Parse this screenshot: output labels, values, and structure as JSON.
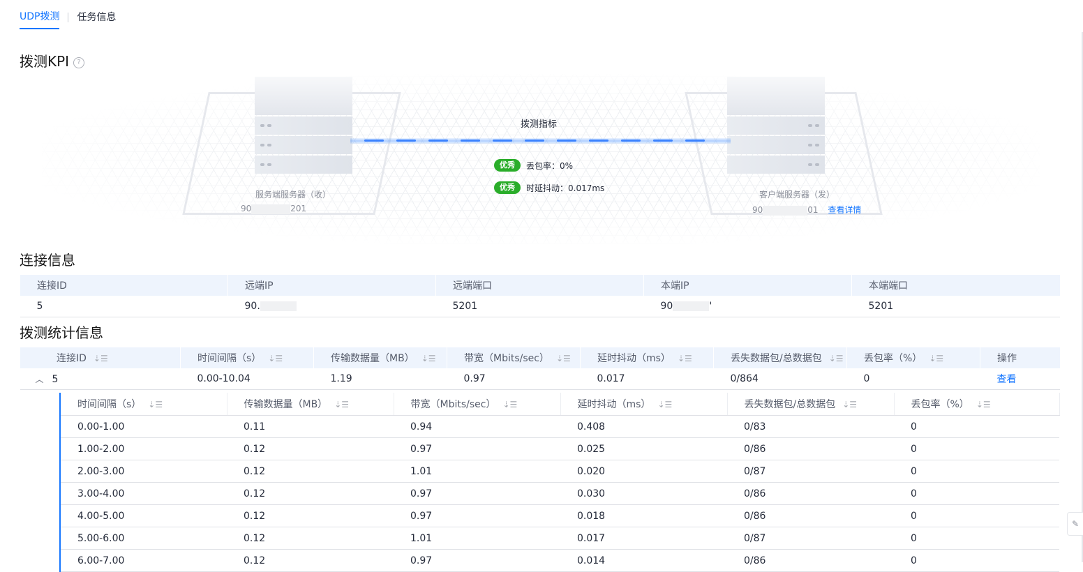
{
  "tabs": [
    {
      "label": "UDP拨测",
      "active": true
    },
    {
      "label": "任务信息",
      "active": false
    }
  ],
  "kpi_section": {
    "title": "拨测KPI",
    "help_icon": "question-circle-icon"
  },
  "topology": {
    "metric_title": "拨测指标",
    "server": {
      "label": "服务端服务器（收）",
      "ip_start": "90",
      "ip_end": "201"
    },
    "client": {
      "label": "客户端服务器（发）",
      "ip_start": "90",
      "ip_end": "01",
      "detail_link": "查看详情"
    },
    "metrics": [
      {
        "badge": "优秀",
        "text": "丢包率：0%"
      },
      {
        "badge": "优秀",
        "text": "时延抖动：0.017ms"
      }
    ],
    "badge_color": "#2aad2a"
  },
  "connection": {
    "title": "连接信息",
    "columns": [
      "连接ID",
      "远端IP",
      "远端端口",
      "本端IP",
      "本端端口"
    ],
    "row": {
      "id": "5",
      "remote_ip": "90.",
      "remote_port": "5201",
      "local_ip": "90",
      "local_ip_tail": "'",
      "local_port": "5201"
    }
  },
  "stats": {
    "title": "拨测统计信息",
    "columns": [
      "连接ID",
      "时间间隔（s）",
      "传输数据量（MB）",
      "带宽（Mbits/sec）",
      "延时抖动（ms）",
      "丢失数据包/总数据包",
      "丢包率（%）",
      "操作"
    ],
    "row": {
      "id": "5",
      "interval": "0.00-10.04",
      "transfer": "1.19",
      "bandwidth": "0.97",
      "jitter": "0.017",
      "lost_total": "0/864",
      "loss_rate": "0",
      "action": "查看"
    },
    "sub_columns": [
      "时间间隔（s）",
      "传输数据量（MB）",
      "带宽（Mbits/sec）",
      "延时抖动（ms）",
      "丢失数据包/总数据包",
      "丢包率（%）"
    ],
    "sub_rows": [
      [
        "0.00-1.00",
        "0.11",
        "0.94",
        "0.408",
        "0/83",
        "0"
      ],
      [
        "1.00-2.00",
        "0.12",
        "0.97",
        "0.025",
        "0/86",
        "0"
      ],
      [
        "2.00-3.00",
        "0.12",
        "1.01",
        "0.020",
        "0/87",
        "0"
      ],
      [
        "3.00-4.00",
        "0.12",
        "0.97",
        "0.030",
        "0/86",
        "0"
      ],
      [
        "4.00-5.00",
        "0.12",
        "0.97",
        "0.018",
        "0/86",
        "0"
      ],
      [
        "5.00-6.00",
        "0.12",
        "1.01",
        "0.017",
        "0/87",
        "0"
      ],
      [
        "6.00-7.00",
        "0.12",
        "0.97",
        "0.014",
        "0/86",
        "0"
      ]
    ]
  },
  "accent_color": "#1476ff"
}
